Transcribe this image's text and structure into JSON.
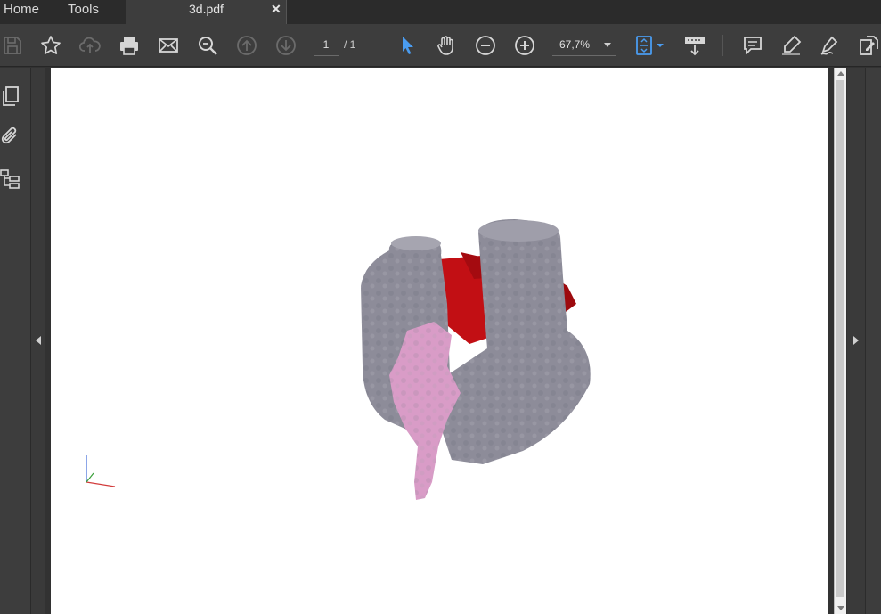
{
  "tabs": {
    "home": "Home",
    "tools": "Tools",
    "document": "3d.pdf"
  },
  "toolbar": {
    "page_current": "1",
    "page_total": "/ 1",
    "zoom": "67,7%"
  },
  "colors": {
    "accent": "#4a9cf0",
    "model_gray": "#8d8c99",
    "model_red": "#c20f14",
    "model_pink": "#d99cc7"
  },
  "icons": [
    "save-icon",
    "bookmark-star-icon",
    "upload-cloud-icon",
    "print-icon",
    "email-icon",
    "zoom-search-icon",
    "prev-page-icon",
    "next-page-icon",
    "select-cursor-icon",
    "hand-icon",
    "zoom-out-icon",
    "zoom-in-icon",
    "fit-page-icon",
    "scroll-mode-icon",
    "comment-icon",
    "highlight-icon",
    "sign-icon",
    "edit-icon",
    "pages-icon",
    "attachment-icon",
    "layers-icon"
  ]
}
